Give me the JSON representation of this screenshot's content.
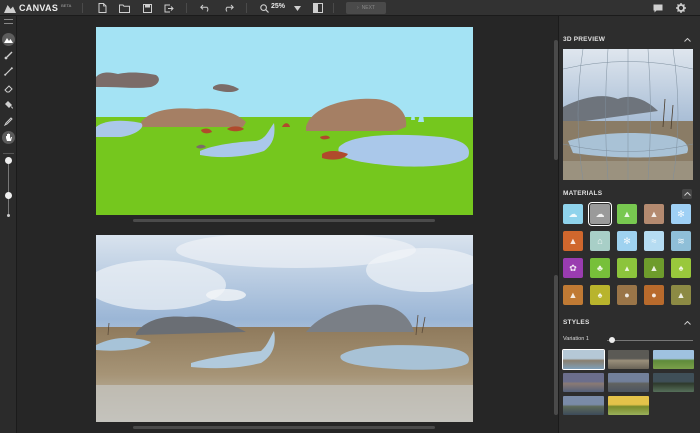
{
  "app": {
    "name": "CANVAS",
    "badge": "BETA"
  },
  "toolbar": {
    "zoom": "25%",
    "next_label": "NEXT",
    "icons": [
      "new-file-icon",
      "open-folder-icon",
      "save-icon",
      "export-icon",
      "undo-icon",
      "redo-icon",
      "search-icon",
      "chevron-down-icon",
      "split-view-icon",
      "chat-icon",
      "gear-icon"
    ]
  },
  "tools": {
    "items": [
      "landscape-tool-icon",
      "brush-icon",
      "line-icon",
      "eraser-icon",
      "fill-bucket-icon",
      "eyedropper-icon",
      "pan-hand-icon"
    ],
    "active": "landscape-tool-icon",
    "brush_size_levels": [
      0.0,
      0.65
    ]
  },
  "panels": {
    "preview_title": "3D PREVIEW",
    "materials_title": "MATERIALS",
    "styles_title": "STYLES",
    "variation_label": "Variation 1",
    "variation_value": 0.05
  },
  "materials": [
    {
      "name": "sky",
      "color": "#8fd3ec",
      "icon": "sky-icon"
    },
    {
      "name": "cloud",
      "color": "#9a9a9a",
      "icon": "cloud-icon",
      "selected": true
    },
    {
      "name": "grass",
      "color": "#78c850",
      "icon": "grass-icon"
    },
    {
      "name": "mountain",
      "color": "#b48a70",
      "icon": "mountain-icon"
    },
    {
      "name": "snow",
      "color": "#9fd0f5",
      "icon": "snowflake-small-icon"
    },
    {
      "name": "dirt",
      "color": "#d0672d",
      "icon": "dirt-icon"
    },
    {
      "name": "fog",
      "color": "#a8cfc7",
      "icon": "house-icon"
    },
    {
      "name": "ice",
      "color": "#9fd2f0",
      "icon": "snowflake-icon"
    },
    {
      "name": "water",
      "color": "#b6dcf2",
      "icon": "water-icon"
    },
    {
      "name": "river",
      "color": "#8fbfd8",
      "icon": "wave-icon"
    },
    {
      "name": "flower",
      "color": "#9a3cb0",
      "icon": "flower-icon"
    },
    {
      "name": "bush",
      "color": "#77c03a",
      "icon": "bush-icon"
    },
    {
      "name": "field",
      "color": "#8cc43c",
      "icon": "field-icon"
    },
    {
      "name": "hill",
      "color": "#6e9c2c",
      "icon": "hill-icon"
    },
    {
      "name": "tree",
      "color": "#99c83c",
      "icon": "tree-icon"
    },
    {
      "name": "sand",
      "color": "#c07a34",
      "icon": "sand-icon"
    },
    {
      "name": "wheat",
      "color": "#b8b42c",
      "icon": "wheat-icon"
    },
    {
      "name": "rock",
      "color": "#9a7548",
      "icon": "rock-icon"
    },
    {
      "name": "earth",
      "color": "#b86a2c",
      "icon": "earth-icon"
    },
    {
      "name": "stone",
      "color": "#8c8a44",
      "icon": "stone-icon"
    }
  ],
  "styles": [
    {
      "name": "style-1",
      "colors": [
        "#b5c8d6",
        "#8a7f6e",
        "#7f9fb8"
      ],
      "selected": true
    },
    {
      "name": "style-2",
      "colors": [
        "#5b5a55",
        "#9a8f7b",
        "#6a6457"
      ]
    },
    {
      "name": "style-3",
      "colors": [
        "#9fc2e0",
        "#5f8b3a",
        "#7aa04a"
      ]
    },
    {
      "name": "style-4",
      "colors": [
        "#6b6e8c",
        "#8a7a74",
        "#55607a"
      ]
    },
    {
      "name": "style-5",
      "colors": [
        "#72809a",
        "#60625f",
        "#4d5561"
      ]
    },
    {
      "name": "style-6",
      "colors": [
        "#3f4f58",
        "#2f3a2c",
        "#56705a"
      ]
    },
    {
      "name": "style-7",
      "colors": [
        "#7a8ba8",
        "#5d6a5a",
        "#3c4a5a"
      ]
    },
    {
      "name": "style-8",
      "colors": [
        "#e4c24a",
        "#7a8a2a",
        "#9ab05a"
      ]
    }
  ]
}
